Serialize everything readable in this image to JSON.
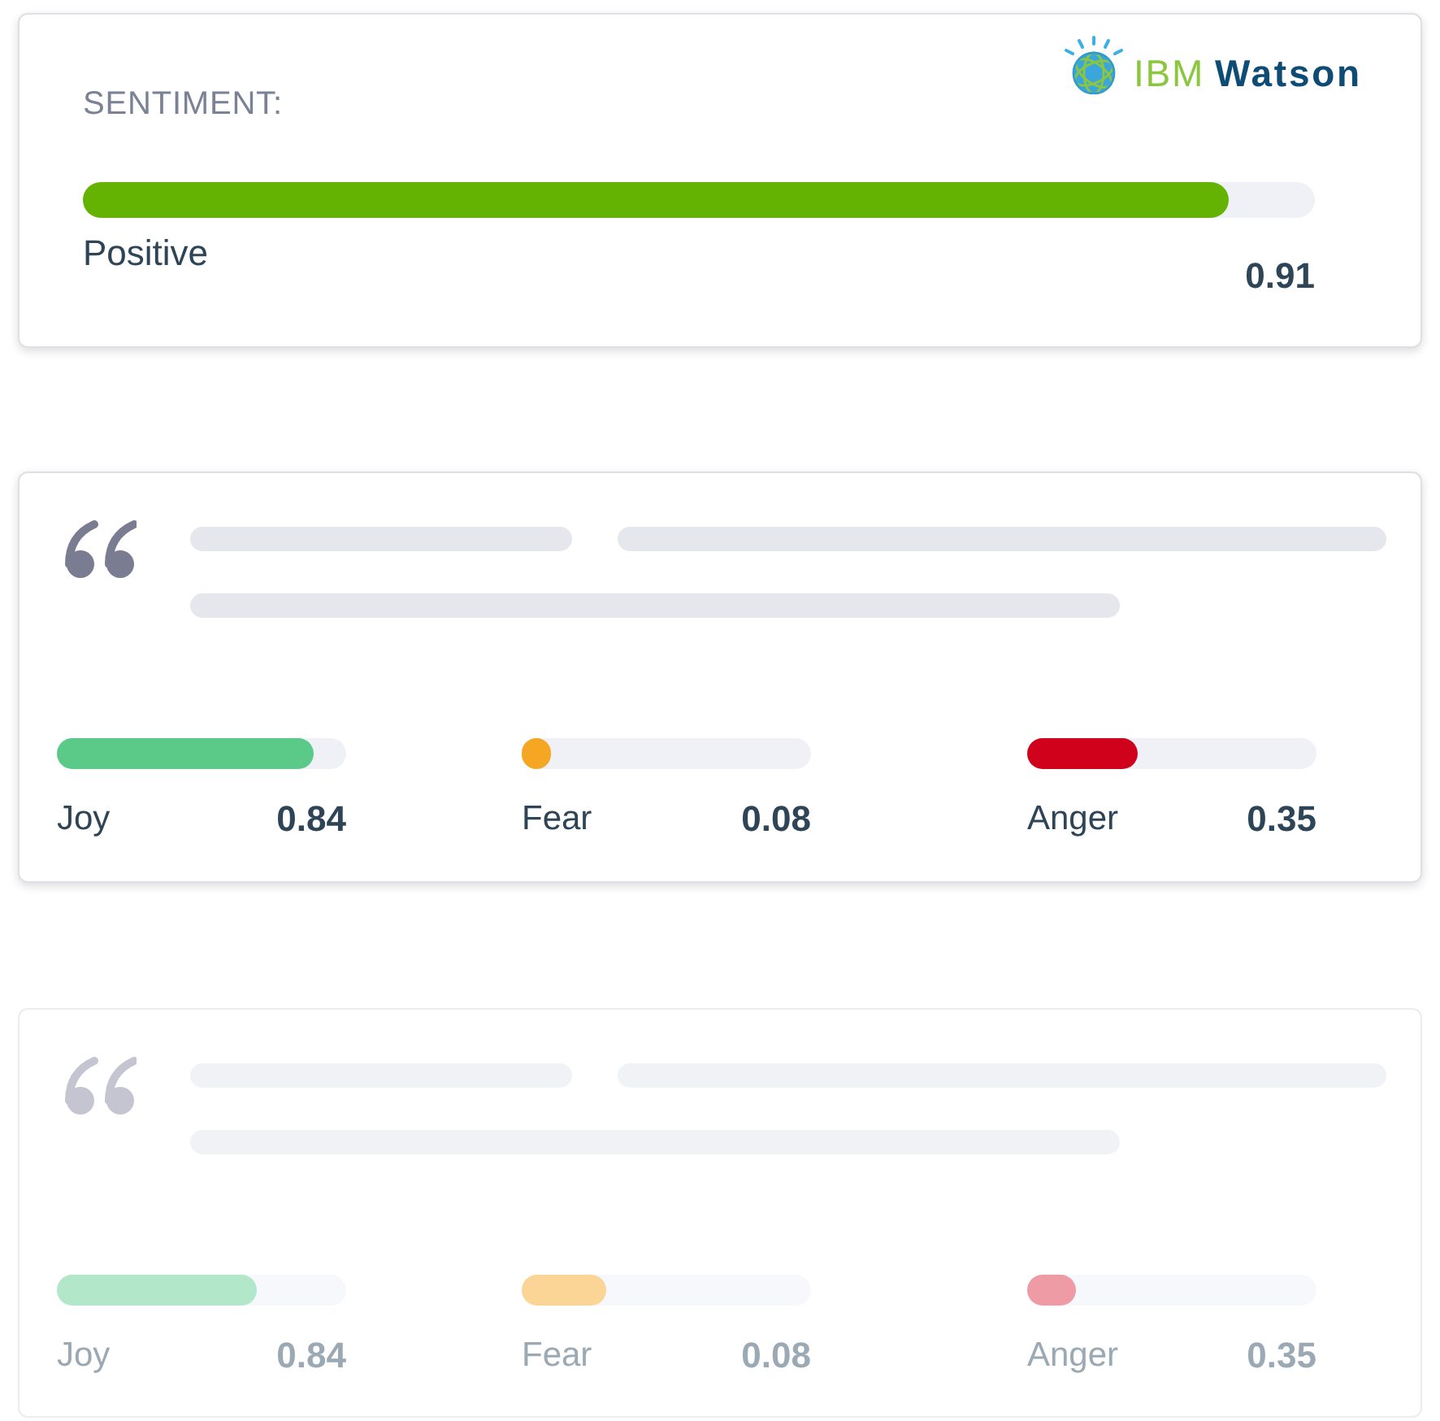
{
  "sentiment_card": {
    "label": "SENTIMENT:",
    "logo": {
      "brand": "IBM",
      "product": "Watson"
    },
    "level": 0.93,
    "result": "Positive",
    "score": "0.91"
  },
  "quote_cards": [
    {
      "faded": false,
      "emotions": [
        {
          "name": "Joy",
          "score": "0.84",
          "level": 0.89,
          "color": "#5bc987"
        },
        {
          "name": "Fear",
          "score": "0.08",
          "level": 0.1,
          "color": "#f5a623"
        },
        {
          "name": "Anger",
          "score": "0.35",
          "level": 0.38,
          "color": "#d0021b"
        }
      ]
    },
    {
      "faded": true,
      "emotions": [
        {
          "name": "Joy",
          "score": "0.84",
          "level": 0.69,
          "color": "#b3e7c9"
        },
        {
          "name": "Fear",
          "score": "0.08",
          "level": 0.29,
          "color": "#fbd596"
        },
        {
          "name": "Anger",
          "score": "0.35",
          "level": 0.17,
          "color": "#ef9ba5"
        }
      ]
    }
  ]
}
